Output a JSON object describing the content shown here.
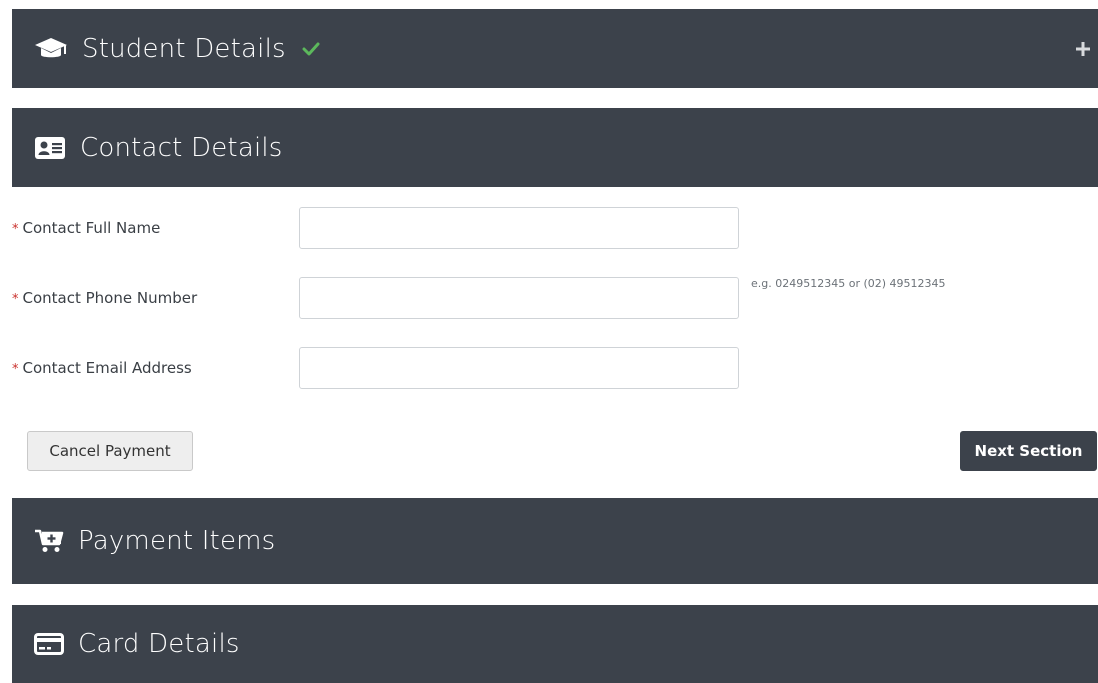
{
  "sections": {
    "student": {
      "title": "Student Details",
      "icon": "graduation-cap-icon",
      "completed": true,
      "expand_symbol": "+"
    },
    "contact": {
      "title": "Contact Details",
      "icon": "address-card-icon"
    },
    "payment": {
      "title": "Payment Items",
      "icon": "cart-plus-icon"
    },
    "card": {
      "title": "Card Details",
      "icon": "credit-card-icon"
    }
  },
  "form": {
    "required_marker": "*",
    "full_name": {
      "label": "Contact Full Name",
      "value": ""
    },
    "phone": {
      "label": "Contact Phone Number",
      "value": "",
      "help": "e.g. 0249512345 or (02) 49512345"
    },
    "email": {
      "label": "Contact Email Address",
      "value": ""
    }
  },
  "buttons": {
    "cancel": "Cancel Payment",
    "next": "Next Section"
  },
  "colors": {
    "header_bg": "#3c424b",
    "check": "#5cb85c",
    "required": "#c9302c"
  }
}
